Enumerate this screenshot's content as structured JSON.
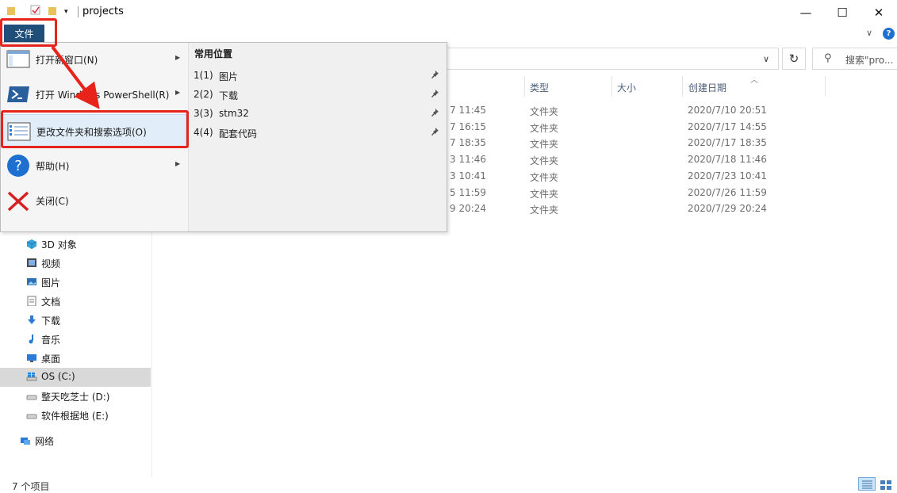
{
  "window": {
    "title": "projects",
    "minimize_glyph": "—",
    "maximize_glyph": "☐",
    "close_glyph": "✕"
  },
  "ribbon": {
    "file_tab_label": "文件",
    "expand_glyph": "∨",
    "help_glyph": "?"
  },
  "address_bar": {
    "dropdown_glyph": "∨",
    "refresh_glyph": "↻"
  },
  "search": {
    "placeholder": "搜索\"pro..."
  },
  "file_menu": {
    "items": [
      {
        "label": "打开新窗口(N)",
        "icon": "new-window-icon",
        "has_submenu": true
      },
      {
        "label": "打开 Windows PowerShell(R)",
        "icon": "powershell-icon",
        "has_submenu": true
      },
      {
        "label": "更改文件夹和搜索选项(O)",
        "icon": "folder-options-icon",
        "has_submenu": false,
        "highlighted": true
      },
      {
        "label": "帮助(H)",
        "icon": "help-icon",
        "has_submenu": true
      },
      {
        "label": "关闭(C)",
        "icon": "close-x-icon",
        "has_submenu": false
      }
    ],
    "recent_title": "常用位置",
    "recent": [
      {
        "num": "1(1)",
        "name": "图片"
      },
      {
        "num": "2(2)",
        "name": "下载"
      },
      {
        "num": "3(3)",
        "name": "stm32"
      },
      {
        "num": "4(4)",
        "name": "配套代码"
      }
    ]
  },
  "columns": {
    "type": "类型",
    "size": "大小",
    "created": "创建日期"
  },
  "rows": [
    {
      "modified": "7 11:45",
      "type": "文件夹",
      "created": "2020/7/10 20:51"
    },
    {
      "modified": "7 16:15",
      "type": "文件夹",
      "created": "2020/7/17 14:55"
    },
    {
      "modified": "7 18:35",
      "type": "文件夹",
      "created": "2020/7/17 18:35"
    },
    {
      "modified": "3 11:46",
      "type": "文件夹",
      "created": "2020/7/18 11:46"
    },
    {
      "modified": "3 10:41",
      "type": "文件夹",
      "created": "2020/7/23 10:41"
    },
    {
      "modified": "5 11:59",
      "type": "文件夹",
      "created": "2020/7/26 11:59"
    },
    {
      "modified": "9 20:24",
      "type": "文件夹",
      "created": "2020/7/29 20:24"
    }
  ],
  "nav": {
    "items": [
      {
        "label": "3D 对象",
        "icon": "3d-objects-icon"
      },
      {
        "label": "视频",
        "icon": "videos-icon"
      },
      {
        "label": "图片",
        "icon": "pictures-icon"
      },
      {
        "label": "文档",
        "icon": "documents-icon"
      },
      {
        "label": "下载",
        "icon": "downloads-icon"
      },
      {
        "label": "音乐",
        "icon": "music-icon"
      },
      {
        "label": "桌面",
        "icon": "desktop-icon"
      },
      {
        "label": "OS (C:)",
        "icon": "drive-c-icon",
        "selected": true
      },
      {
        "label": "整天吃芝士 (D:)",
        "icon": "drive-d-icon"
      },
      {
        "label": "软件根据地 (E:)",
        "icon": "drive-e-icon"
      }
    ],
    "network_label": "网络"
  },
  "status": {
    "item_count": "7 个项目"
  },
  "colors": {
    "annotation_red": "#e8231c",
    "file_tab_bg": "#1f4e79",
    "selection_gray": "#d9d9d9"
  }
}
